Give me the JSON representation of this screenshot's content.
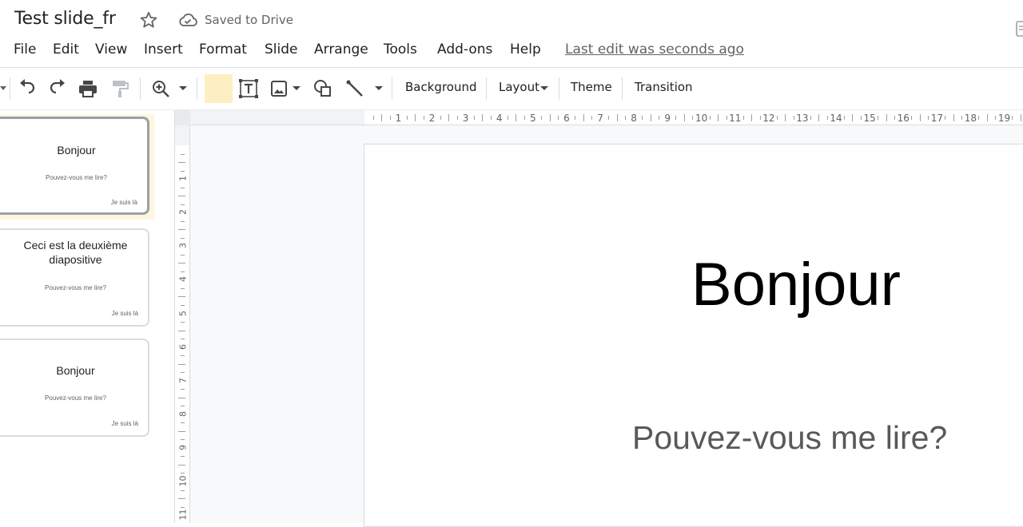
{
  "title_bar": {
    "doc_title": "Test slide_fr",
    "save_status": "Saved to Drive"
  },
  "menu": {
    "items": [
      "File",
      "Edit",
      "View",
      "Insert",
      "Format",
      "Slide",
      "Arrange",
      "Tools",
      "Add-ons",
      "Help"
    ],
    "last_edit": "Last edit was seconds ago"
  },
  "toolbar": {
    "icons": [
      "undo-icon",
      "redo-icon",
      "print-icon",
      "paint-format-icon",
      "zoom-icon",
      "select-icon",
      "text-box-icon",
      "image-icon",
      "shape-icon",
      "line-icon"
    ],
    "background_label": "Background",
    "layout_label": "Layout",
    "theme_label": "Theme",
    "transition_label": "Transition",
    "highlight_color": "#fdefc3"
  },
  "filmstrip": {
    "slides": [
      {
        "title": "Bonjour",
        "subtitle": "Pouvez-vous me lire?",
        "footer": "Je suis là",
        "selected": true
      },
      {
        "title": "Ceci est la deuxième diapositive",
        "subtitle": "Pouvez-vous me lire?",
        "footer": "Je suis là",
        "selected": false
      },
      {
        "title": "Bonjour",
        "subtitle": "Pouvez-vous me lire?",
        "footer": "Je suis là",
        "selected": false
      }
    ]
  },
  "rulers": {
    "horizontal": [
      "1",
      "2",
      "3",
      "4",
      "5",
      "6",
      "7",
      "8",
      "9",
      "10",
      "11",
      "12",
      "13",
      "14",
      "15",
      "16",
      "17",
      "18",
      "19"
    ],
    "vertical": [
      "1",
      "2",
      "3",
      "4",
      "5",
      "6",
      "7",
      "8",
      "9",
      "10",
      "11"
    ]
  },
  "slide": {
    "title": "Bonjour",
    "subtitle": "Pouvez-vous me lire?"
  }
}
